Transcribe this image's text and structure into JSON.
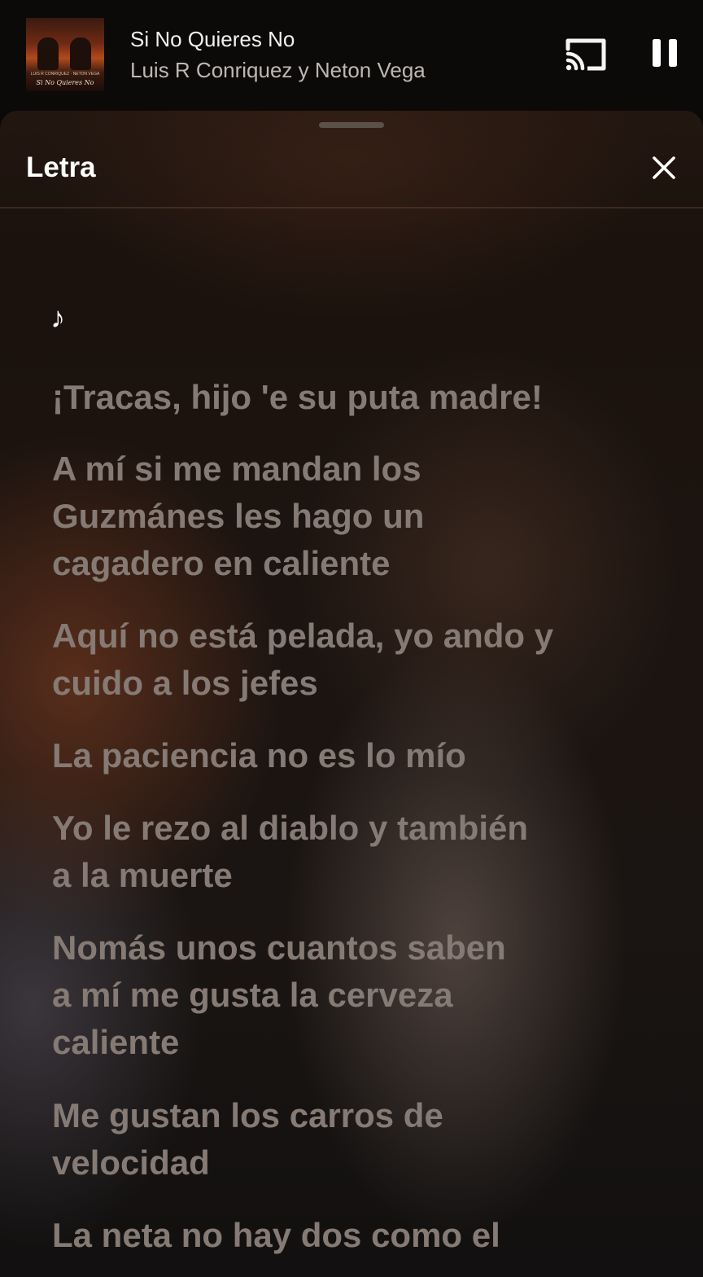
{
  "now_playing": {
    "title": "Si No Quieres No",
    "artist": "Luis R Conriquez y Neton Vega",
    "album_art_text": "Si No Quieres No",
    "album_art_subtext": "LUIS R CONRIQUEZ · NETON VEGA"
  },
  "controls": {
    "cast_icon": "cast-icon",
    "pause_icon": "pause-icon"
  },
  "sheet": {
    "title": "Letra",
    "close_icon": "close-icon"
  },
  "lyrics": {
    "note": "♪",
    "lines": [
      "¡Tracas, hijo 'e su puta madre!",
      "A mí si me mandan los",
      "Guzmánes les hago un",
      "cagadero en caliente",
      "Aquí no está pelada, yo ando y",
      "cuido a los jefes",
      "La paciencia no es lo mío",
      "Yo le rezo al diablo y también",
      "a la muerte",
      "Nomás unos cuantos saben",
      "a mí me gusta la cerveza",
      "caliente",
      "Me gustan los carros de",
      "velocidad",
      "La neta no hay dos como el"
    ]
  },
  "colors": {
    "lyric_text": "#857a74",
    "active_text": "#ffffff",
    "background": "#1c1410"
  }
}
